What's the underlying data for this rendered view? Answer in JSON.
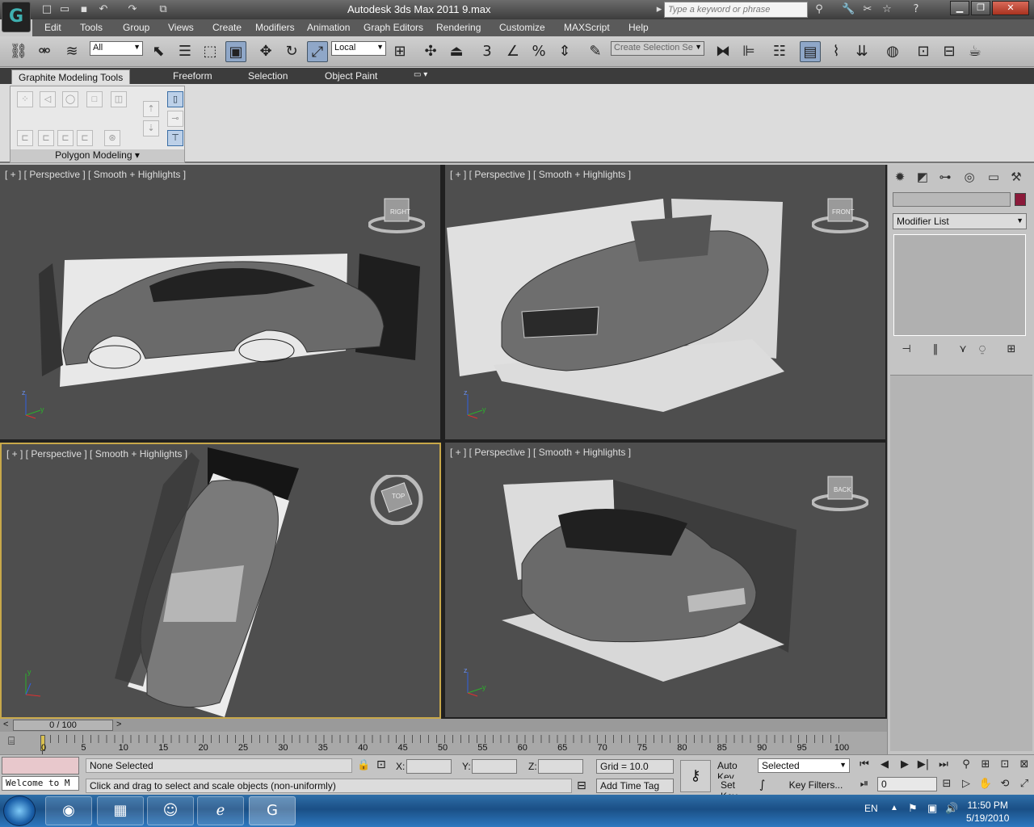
{
  "window": {
    "title": "Autodesk 3ds Max  2011      9.max",
    "search_placeholder": "Type a keyword or phrase"
  },
  "menu": [
    "Edit",
    "Tools",
    "Group",
    "Views",
    "Create",
    "Modifiers",
    "Animation",
    "Graph Editors",
    "Rendering",
    "Customize",
    "MAXScript",
    "Help"
  ],
  "toolbar": {
    "selection_filter": "All",
    "ref_coord": "Local",
    "named_selection": "Create Selection Se",
    "snap_label": "3"
  },
  "ribbon": {
    "tabs": [
      "Graphite Modeling Tools",
      "Freeform",
      "Selection",
      "Object Paint"
    ],
    "group_label": "Polygon Modeling"
  },
  "viewports": [
    {
      "label": "[ + ] [ Perspective ] [ Smooth + Highlights ]",
      "cube": "RIGHT"
    },
    {
      "label": "[ + ] [ Perspective ] [ Smooth + Highlights ]",
      "cube": "FRONT"
    },
    {
      "label": "[ + ] [ Perspective ] [ Smooth + Highlights ]",
      "cube": "TOP"
    },
    {
      "label": "[ + ] [ Perspective ] [ Smooth + Highlights ]",
      "cube": "BACK"
    }
  ],
  "command_panel": {
    "modifier_list": "Modifier List",
    "object_color": "#8b1a3a"
  },
  "timeline": {
    "frame": "0 / 100",
    "ticks": [
      "0",
      "5",
      "10",
      "15",
      "20",
      "25",
      "30",
      "35",
      "40",
      "45",
      "50",
      "55",
      "60",
      "65",
      "70",
      "75",
      "80",
      "85",
      "90",
      "95",
      "100"
    ]
  },
  "status": {
    "maxscript": "Welcome to M",
    "selection": "None Selected",
    "prompt": "Click and drag to select and scale objects (non-uniformly)",
    "x_label": "X:",
    "y_label": "Y:",
    "z_label": "Z:",
    "grid": "Grid = 10.0",
    "add_time_tag": "Add Time Tag",
    "auto_key": "Auto Key",
    "set_key": "Set Key",
    "key_mode": "Selected",
    "key_filters": "Key Filters...",
    "current_frame": "0"
  },
  "taskbar": {
    "language": "EN",
    "time": "11:50 PM",
    "date": "5/19/2010"
  }
}
